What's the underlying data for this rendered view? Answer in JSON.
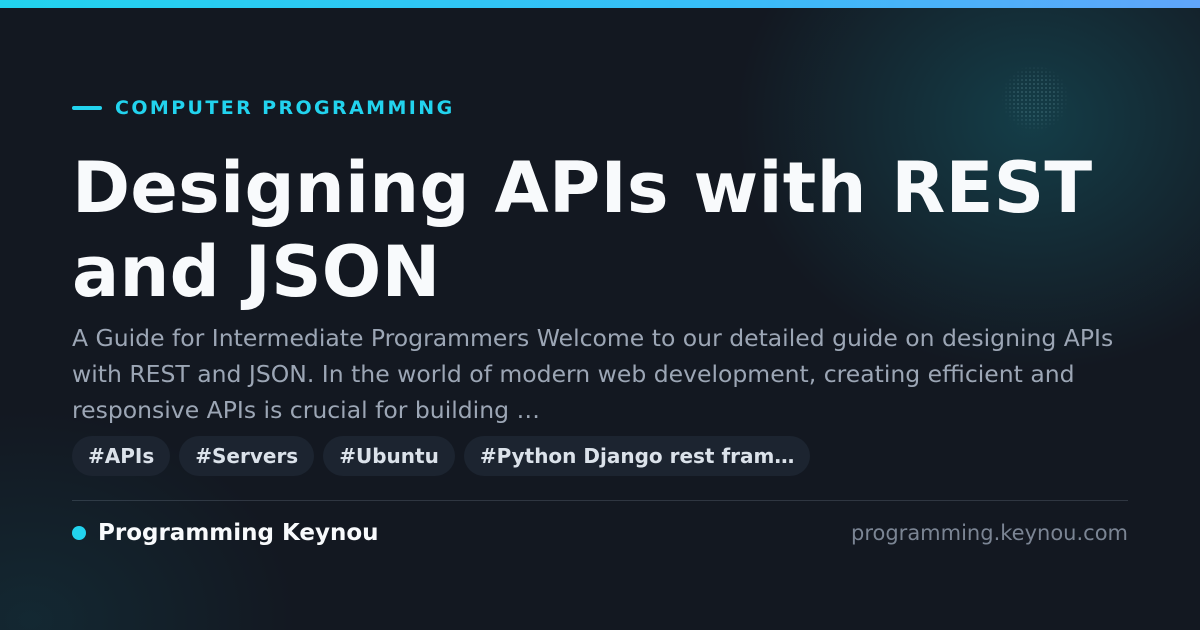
{
  "category": "COMPUTER PROGRAMMING",
  "title": "Designing APIs with REST and JSON",
  "description": "A Guide for Intermediate Programmers Welcome to our detailed guide on designing APIs with REST and JSON. In the world of modern web development, creating efficient and responsive APIs is crucial for building …",
  "tags": [
    "#APIs",
    "#Servers",
    "#Ubuntu",
    "#Python Django rest fram…"
  ],
  "brand": "Programming Keynou",
  "domain": "programming.keynou.com",
  "colors": {
    "accent": "#22d3ee",
    "background": "#131821",
    "title": "#f8fafc",
    "description": "#9ca6b5",
    "tag_background": "#1c2430",
    "domain": "#7b8594"
  }
}
